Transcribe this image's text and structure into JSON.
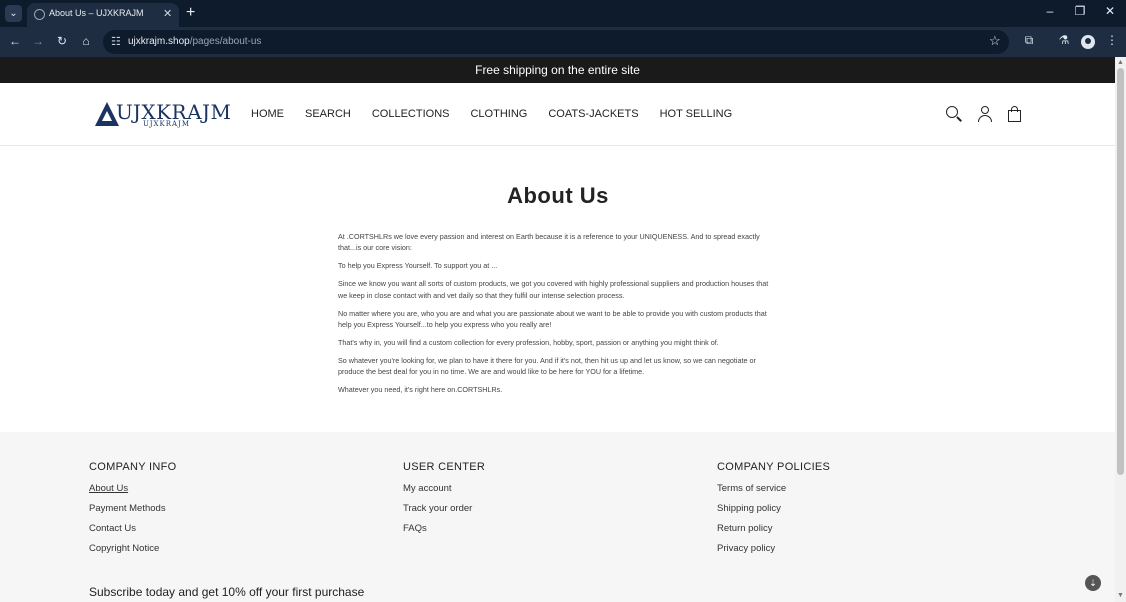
{
  "browser": {
    "tab_title": "About Us – UJXKRAJM",
    "url_host": "ujxkrajm.shop",
    "url_path": "/pages/about-us"
  },
  "announcement": "Free shipping on the entire site",
  "logo": {
    "text": "UJXKRAJM",
    "subtext": "UJXKRAJM"
  },
  "nav": [
    "HOME",
    "SEARCH",
    "COLLECTIONS",
    "CLOTHING",
    "COATS-JACKETS",
    "HOT SELLING"
  ],
  "page": {
    "title": "About Us",
    "paragraphs": [
      "At .CORTSHLRs we love every passion and interest on Earth because it is a reference to your UNIQUENESS. And to spread exactly that...is our core vision:",
      "To help you Express Yourself. To support you at ...",
      "Since we know you want all sorts of custom products, we got you covered with highly professional suppliers and production houses that we keep in close contact with and vet daily so that they fulfil our intense selection process.",
      "No matter where you are, who you are and what you are passionate about we want to be able to provide you with custom products that help you Express Yourself...to help you express who you really are!",
      "That's why in, you will find a custom collection for every profession, hobby, sport, passion or anything you might think of.",
      "So whatever you're looking for, we plan to have it there for you. And if it's not, then hit us up and let us know, so we can negotiate or produce the best deal for you in no time. We are and would like to be here for YOU for a lifetime.",
      "Whatever you need, it's right here on.CORTSHLRs."
    ]
  },
  "footer": {
    "company_info": {
      "heading": "COMPANY INFO",
      "links": [
        "About Us",
        "Payment Methods",
        "Contact Us",
        "Copyright Notice"
      ]
    },
    "user_center": {
      "heading": "USER CENTER",
      "links": [
        "My account",
        "Track your order",
        "FAQs"
      ]
    },
    "company_policies": {
      "heading": "COMPANY POLICIES",
      "links": [
        "Terms of service",
        "Shipping policy",
        "Return policy",
        "Privacy policy"
      ]
    },
    "subscribe": "Subscribe today and get 10% off your first purchase"
  },
  "colors": {
    "announcement_bg": "#1a1a1a",
    "logo": "#1a3360",
    "footer_bg": "#f6f6f6"
  }
}
